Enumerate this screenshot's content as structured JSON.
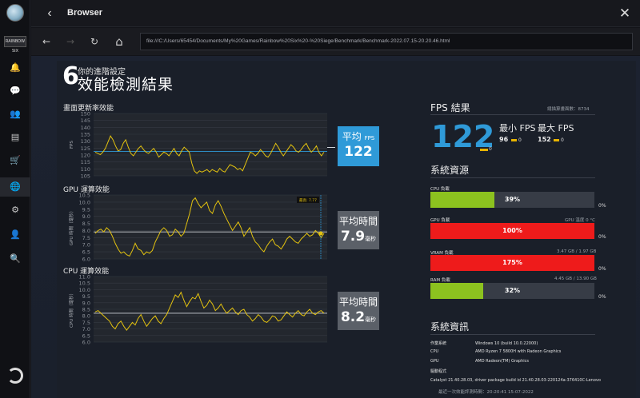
{
  "window": {
    "title": "Browser",
    "back_glyph": "‹",
    "close_glyph": "✕"
  },
  "sidebar": {
    "logo_text": "RAINBOW SIX",
    "items": [
      {
        "icon": "bell-icon",
        "glyph": "🔔"
      },
      {
        "icon": "chat-icon",
        "glyph": "💬"
      },
      {
        "icon": "friends-icon",
        "glyph": "👥"
      },
      {
        "icon": "library-icon",
        "glyph": "▤"
      },
      {
        "icon": "store-icon",
        "glyph": "🛒"
      },
      {
        "icon": "globe-icon",
        "glyph": "🌐"
      },
      {
        "icon": "settings-icon",
        "glyph": "⚙"
      },
      {
        "icon": "account-icon",
        "glyph": "👤"
      },
      {
        "icon": "search-icon",
        "glyph": "🔍"
      }
    ]
  },
  "navbar": {
    "back_glyph": "←",
    "forward_glyph": "→",
    "reload_glyph": "↻",
    "home_glyph": "⌂",
    "url": "file:///C:/Users/65454/Documents/My%20Games/Rainbow%20Six%20-%20Siege/Benchmark/Benchmark-2022.07.15-20.20.46.html"
  },
  "report": {
    "six": "6",
    "subtitle": "你的進階設定",
    "title": "效能檢測結果",
    "fps_section": "畫面更新率效能",
    "gpu_section": "GPU 運算效能",
    "cpu_section": "CPU 運算效能",
    "fps_axis": "FPS",
    "gpu_axis": "GPU 時間（毫秒）",
    "cpu_axis": "CPU 時間（毫秒）",
    "gpu_marker": "最高: 7.77",
    "avg_fps_label": "平均",
    "avg_fps_unit": "FPS",
    "avg_fps_value": "122",
    "avg_gpu_label": "平均時間",
    "avg_gpu_value": "7.9",
    "avg_gpu_unit": "毫秒",
    "avg_cpu_label": "平均時間",
    "avg_cpu_value": "8.2",
    "avg_cpu_unit": "毫秒"
  },
  "results": {
    "title": "FPS 結果",
    "frames": "總描算畫面數：8734",
    "fps": "122",
    "fps_zero": "0",
    "min_label": "最小 FPS",
    "max_label": "最大 FPS",
    "min_value": "96",
    "max_value": "152",
    "min_zero": "0",
    "max_zero": "0"
  },
  "resources": {
    "title": "系統資源",
    "bars": [
      {
        "label": "CPU 負載",
        "value": "39%",
        "fill": 0.39,
        "color": "#8cc21f",
        "note": "",
        "zero": "0%"
      },
      {
        "label": "GPU 負載",
        "value": "100%",
        "fill": 1.0,
        "color": "#ee1b1b",
        "note": "GPU 溫度 0 °C",
        "zero": "0%"
      },
      {
        "label": "VRAM 負載",
        "value": "175%",
        "fill": 1.0,
        "color": "#ee1b1b",
        "note": "3.47 GB / 1.97 GB",
        "zero": "0%"
      },
      {
        "label": "RAM 負載",
        "value": "32%",
        "fill": 0.32,
        "color": "#8cc21f",
        "note": "4.45 GB / 13.90 GB",
        "zero": "0%"
      }
    ]
  },
  "sysinfo": {
    "title": "系統資訊",
    "rows": [
      {
        "k": "作業系統",
        "v": "Windows 10 (build 10.0.22000)"
      },
      {
        "k": "CPU",
        "v": "AMD Ryzen 7 5800H with Radeon Graphics"
      },
      {
        "k": "GPU",
        "v": "AMD Radeon(TM) Graphics"
      },
      {
        "k": "驅動程式",
        "v": ""
      },
      {
        "k": "Catalyst 21.40.28.03, driver package build id 21.40.28.03-220124a-376410C-Lenovo",
        "v": ""
      }
    ],
    "footer": "最近一次效能評測時間：20:20:41 15-07-2022"
  },
  "charts": {
    "fps": {
      "yticks": [
        "150",
        "145",
        "140",
        "135",
        "130",
        "125",
        "120",
        "115",
        "110",
        "105"
      ],
      "ymin": 102,
      "ymax": 152,
      "avg": 121.5,
      "values": [
        121,
        120,
        119,
        121,
        124,
        129,
        134,
        131,
        126,
        122,
        123,
        128,
        131,
        125,
        120,
        118,
        121,
        124,
        126,
        123,
        121,
        120,
        122,
        124,
        121,
        117,
        119,
        121,
        120,
        118,
        121,
        124,
        120,
        118,
        122,
        125,
        123,
        121,
        112,
        106,
        104,
        106,
        105,
        106,
        107,
        105,
        107,
        106,
        105,
        108,
        106,
        105,
        108,
        111,
        110,
        109,
        107,
        108,
        106,
        111,
        116,
        121,
        120,
        118,
        120,
        123,
        121,
        118,
        117,
        120,
        124,
        128,
        125,
        121,
        118,
        121,
        124,
        127,
        125,
        122,
        121,
        123,
        126,
        128,
        124,
        121,
        123,
        126,
        121,
        118,
        121
      ]
    },
    "gpu": {
      "yticks": [
        "10.5",
        "10.0",
        "9.5",
        "9.0",
        "8.5",
        "8.0",
        "7.5",
        "7.0",
        "6.5",
        "6.0"
      ],
      "ymin": 6.0,
      "ymax": 10.5,
      "avg": 7.9,
      "values": [
        7.8,
        8.0,
        8.1,
        7.9,
        8.2,
        8.0,
        7.6,
        7.1,
        6.7,
        6.4,
        6.5,
        6.3,
        6.2,
        6.6,
        7.1,
        6.7,
        6.6,
        6.3,
        6.5,
        6.4,
        6.6,
        7.2,
        7.6,
        8.0,
        8.2,
        8.0,
        7.6,
        7.7,
        8.1,
        7.9,
        7.6,
        7.8,
        8.5,
        9.2,
        10.1,
        10.3,
        9.9,
        9.6,
        9.8,
        10.0,
        9.4,
        9.2,
        9.8,
        10.1,
        9.7,
        9.2,
        8.8,
        8.4,
        8.0,
        8.3,
        8.6,
        8.2,
        7.6,
        7.9,
        8.2,
        7.6,
        7.2,
        7.0,
        6.7,
        6.5,
        6.9,
        7.2,
        7.4,
        7.0,
        6.9,
        6.7,
        7.0,
        7.4,
        7.6,
        7.4,
        7.2,
        7.1,
        7.4,
        7.6,
        7.8,
        7.6,
        7.7,
        8.0,
        7.8,
        7.5,
        7.8
      ]
    },
    "cpu": {
      "yticks": [
        "11.0",
        "10.5",
        "10.0",
        "9.5",
        "9.0",
        "8.5",
        "8.0",
        "7.5",
        "7.0",
        "6.5",
        "6.0"
      ],
      "ymin": 6.0,
      "ymax": 11.0,
      "avg": 8.2,
      "values": [
        8.3,
        8.4,
        8.2,
        8.0,
        7.8,
        7.6,
        7.2,
        7.0,
        7.4,
        7.6,
        7.2,
        6.9,
        7.2,
        7.5,
        7.3,
        7.8,
        8.1,
        7.6,
        7.2,
        7.5,
        7.8,
        8.0,
        7.6,
        7.4,
        7.8,
        8.1,
        8.6,
        9.1,
        9.6,
        9.4,
        9.8,
        9.2,
        8.7,
        9.1,
        9.4,
        9.3,
        9.7,
        9.1,
        8.6,
        8.8,
        9.2,
        8.9,
        8.4,
        8.6,
        8.9,
        8.5,
        8.2,
        8.4,
        8.6,
        8.3,
        8.1,
        8.4,
        8.5,
        8.1,
        7.9,
        7.6,
        7.8,
        8.1,
        7.9,
        7.6,
        7.5,
        7.7,
        8.0,
        7.9,
        7.6,
        7.7,
        8.0,
        8.3,
        8.1,
        7.9,
        8.2,
        8.4,
        8.1,
        8.0,
        8.3,
        8.5,
        8.2,
        8.1,
        8.3,
        8.4,
        8.2
      ]
    }
  }
}
